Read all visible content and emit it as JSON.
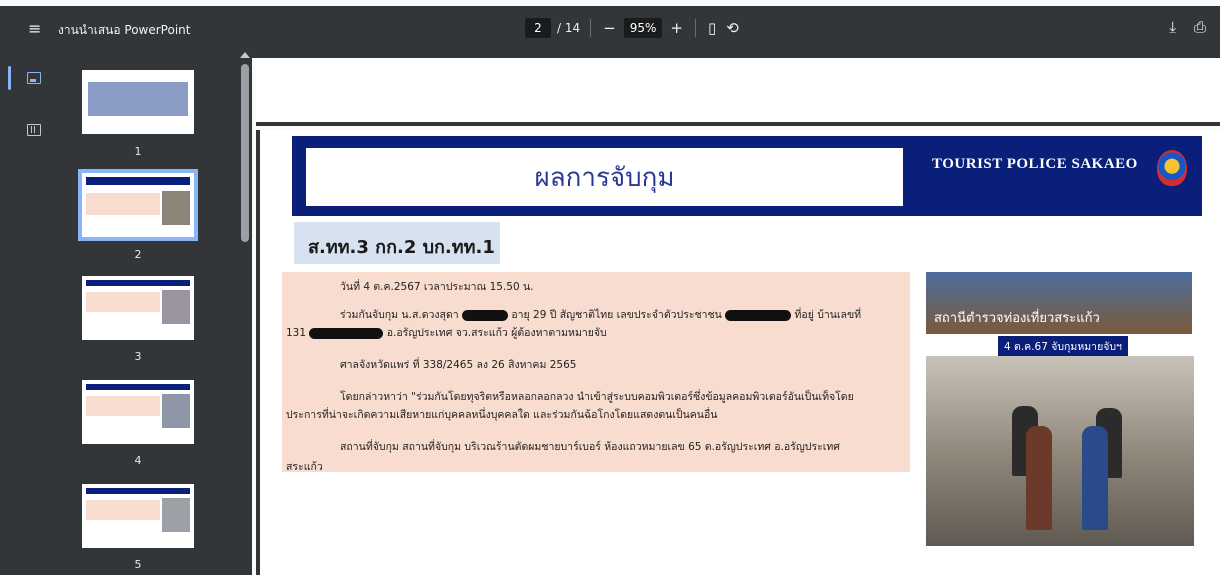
{
  "toolbar": {
    "title": "งานนำเสนอ PowerPoint",
    "current_page": "2",
    "total_pages": "/ 14",
    "zoom": "95%",
    "zoom_out": "−",
    "zoom_in": "+"
  },
  "thumbnails": [
    {
      "number": "1"
    },
    {
      "number": "2",
      "active": true
    },
    {
      "number": "3"
    },
    {
      "number": "4"
    },
    {
      "number": "5"
    }
  ],
  "slide": {
    "title": "ผลการจับกุม",
    "agency": "TOURIST POLICE SAKAEO",
    "unit": "ส.ทท.3 กก.2 บก.ทท.1",
    "paragraphs": {
      "p1": "วันที่ 4 ต.ค.2567 เวลาประมาณ 15.50 น.",
      "p2a": "ร่วมกันจับกุม น.ส.ดวงสุดา",
      "p2b": "อายุ 29 ปี สัญชาติไทย เลขประจำตัวประชาชน",
      "p2c": "ที่อยู่ บ้านเลขที่",
      "p2d": "131",
      "p2e": "อ.อรัญประเทศ จว.สระแก้ว ผู้ต้องหาตามหมายจับ",
      "p3": "ศาลจังหวัดแพร่ ที่ 338/2465 ลง 26 สิงหาคม 2565",
      "p4a": "โดยกล่าวหาว่า \"ร่วมกันโดยทุจริตหรือหลอกลอกลวง นำเข้าสู่ระบบคอมพิวเตอร์ซึ่งข้อมูลคอมพิวเตอร์อันเป็นเท็จโดย",
      "p4b": "ประการที่น่าจะเกิดความเสียหายแก่บุคคลหนึ่งบุคคลใด และร่วมกันฉ้อโกงโดยแสดงตนเป็นคนอื่น",
      "p5a": "สถานที่จับกุม สถานที่จับกุม บริเวณร้านตัดผมชายบาร์เบอร์ ห้องแถวหมายเลข 65 ต.อรัญประเทศ อ.อรัญประเทศ",
      "p5b": "สระแก้ว"
    },
    "photo_header": "สถานีตำรวจท่องเที่ยวสระแก้ว",
    "photo_date": "4 ต.ค.67 จับกุมหมายจับฯ"
  },
  "colors": {
    "toolbar_bg": "#323639",
    "accent": "#8ab4f8",
    "banner_blue": "#0a1f7a",
    "content_pink": "#f9dcd0"
  },
  "icons": {
    "menu": "hamburger-icon",
    "download": "download-icon",
    "print": "print-icon",
    "fit": "fit-page-icon",
    "rotate": "rotate-icon"
  }
}
